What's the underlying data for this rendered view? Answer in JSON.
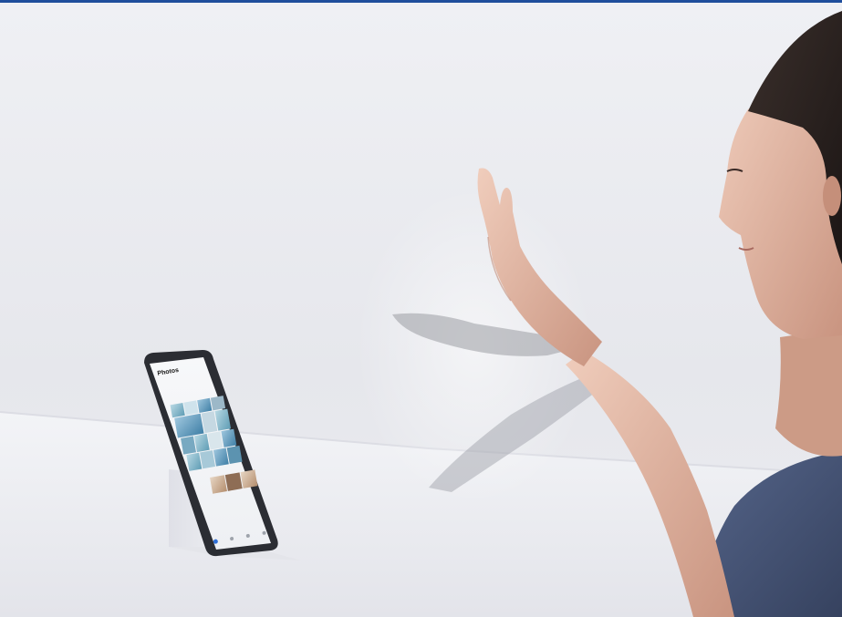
{
  "phone": {
    "app_title": "Photos",
    "section_dates": [
      "",
      ""
    ],
    "nav_tabs": [
      "",
      "",
      "",
      ""
    ]
  },
  "colors": {
    "background": "#eceef2",
    "top_rule": "#1f4e9c",
    "skin": "#e3b9a4",
    "hair": "#2a2220",
    "sweater": "#4a5878",
    "phone_frame": "#2b2d33"
  }
}
